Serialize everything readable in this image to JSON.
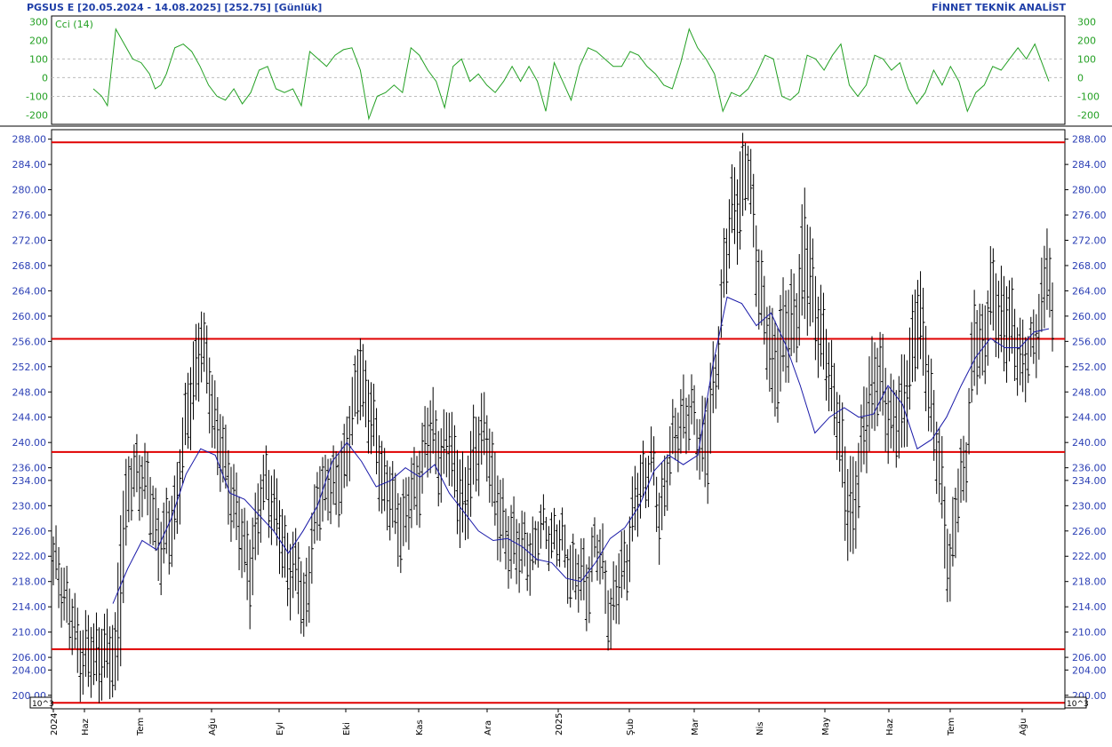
{
  "header": {
    "left": "PGSUS E  [20.05.2024 - 14.08.2025]  [252.75]  [Günlük]",
    "right": "FİNNET TEKNİK ANALİST"
  },
  "indicator": {
    "label": "Cci (14)",
    "color": "#23a023",
    "ticks": [
      "300",
      "200",
      "100",
      "0",
      "-100",
      "-200"
    ],
    "tick_values": [
      300,
      200,
      100,
      0,
      -100,
      -200
    ],
    "ylim": [
      -250,
      330
    ]
  },
  "scale_label": "10^3",
  "colors": {
    "price_bar": "#000000",
    "moving_average": "#1a1aa8",
    "levels": "#e00000",
    "cci": "#23a023",
    "axis_text": "#2b3fb5"
  },
  "chart_data": {
    "type": "bar",
    "title": "PGSUS E",
    "date_range": "20.05.2024 - 14.08.2025",
    "last_price": 252.75,
    "period": "Günlük",
    "ylim": [
      198,
      289.5
    ],
    "y_ticks": [
      288,
      284,
      280,
      276,
      272,
      268,
      264,
      260,
      256,
      252,
      248,
      244,
      240,
      236,
      234,
      230,
      226,
      222,
      218,
      214,
      210,
      206,
      204,
      200
    ],
    "x_labels": [
      "2024",
      "Haz",
      "Tem",
      "Ağu",
      "Eyl",
      "Eki",
      "Kas",
      "Ara",
      "2025",
      "Şub",
      "Mar",
      "Nis",
      "May",
      "Haz",
      "Tem",
      "Ağu"
    ],
    "horizontal_levels": [
      287.5,
      256.4,
      238.5,
      207.3,
      198.8
    ],
    "ohlc_keypoints": [
      [
        0,
        216,
        224
      ],
      [
        3,
        214,
        222
      ],
      [
        6,
        208,
        216
      ],
      [
        9,
        203,
        212
      ],
      [
        12,
        201,
        211
      ],
      [
        15,
        200,
        210
      ],
      [
        18,
        202,
        212
      ],
      [
        21,
        200,
        210
      ],
      [
        23,
        199,
        211
      ],
      [
        25,
        208,
        230
      ],
      [
        28,
        227,
        236
      ],
      [
        31,
        232,
        240
      ],
      [
        34,
        228,
        237
      ],
      [
        37,
        224,
        233
      ],
      [
        40,
        218,
        228
      ],
      [
        43,
        220,
        230
      ],
      [
        46,
        226,
        236
      ],
      [
        49,
        236,
        246
      ],
      [
        52,
        244,
        256
      ],
      [
        55,
        250,
        260
      ],
      [
        58,
        244,
        254
      ],
      [
        61,
        235,
        246
      ],
      [
        64,
        230,
        240
      ],
      [
        67,
        226,
        236
      ],
      [
        70,
        218,
        228
      ],
      [
        73,
        214,
        226
      ],
      [
        76,
        222,
        232
      ],
      [
        79,
        230,
        238
      ],
      [
        82,
        224,
        234
      ],
      [
        85,
        218,
        228
      ],
      [
        88,
        215,
        225
      ],
      [
        91,
        213,
        223
      ],
      [
        93,
        208,
        218
      ],
      [
        96,
        218,
        228
      ],
      [
        99,
        226,
        236
      ],
      [
        102,
        230,
        238
      ],
      [
        105,
        226,
        236
      ],
      [
        108,
        232,
        242
      ],
      [
        111,
        238,
        248
      ],
      [
        114,
        246,
        257
      ],
      [
        117,
        240,
        250
      ],
      [
        120,
        234,
        244
      ],
      [
        123,
        228,
        238
      ],
      [
        126,
        224,
        234
      ],
      [
        129,
        222,
        232
      ],
      [
        132,
        224,
        234
      ],
      [
        135,
        228,
        238
      ],
      [
        138,
        234,
        244
      ],
      [
        141,
        236,
        246
      ],
      [
        144,
        232,
        242
      ],
      [
        147,
        234,
        244
      ],
      [
        150,
        228,
        240
      ],
      [
        153,
        222,
        234
      ],
      [
        156,
        232,
        244
      ],
      [
        159,
        236,
        246
      ],
      [
        162,
        232,
        242
      ],
      [
        165,
        224,
        236
      ],
      [
        168,
        218,
        228
      ],
      [
        171,
        220,
        230
      ],
      [
        174,
        217,
        226
      ],
      [
        177,
        218,
        226
      ],
      [
        180,
        222,
        228
      ],
      [
        183,
        223,
        228
      ],
      [
        186,
        222,
        228
      ],
      [
        189,
        220,
        226
      ],
      [
        192,
        216,
        224
      ],
      [
        195,
        214,
        222
      ],
      [
        198,
        212,
        222
      ],
      [
        201,
        220,
        226
      ],
      [
        204,
        216,
        224
      ],
      [
        207,
        208,
        216
      ],
      [
        210,
        212,
        222
      ],
      [
        213,
        218,
        226
      ],
      [
        216,
        224,
        234
      ],
      [
        219,
        230,
        238
      ],
      [
        222,
        234,
        240
      ],
      [
        225,
        222,
        232
      ],
      [
        228,
        232,
        240
      ],
      [
        231,
        236,
        244
      ],
      [
        234,
        240,
        249
      ],
      [
        237,
        240,
        247
      ],
      [
        240,
        236,
        244
      ],
      [
        243,
        232,
        248
      ],
      [
        246,
        246,
        254
      ],
      [
        249,
        262,
        272
      ],
      [
        252,
        270,
        280
      ],
      [
        255,
        272,
        286
      ],
      [
        258,
        279,
        287
      ],
      [
        261,
        264,
        276
      ],
      [
        264,
        254,
        264
      ],
      [
        267,
        244,
        258
      ],
      [
        270,
        248,
        262
      ],
      [
        273,
        250,
        264
      ],
      [
        276,
        256,
        266
      ],
      [
        279,
        258,
        278
      ],
      [
        282,
        258,
        270
      ],
      [
        285,
        250,
        262
      ],
      [
        288,
        246,
        256
      ],
      [
        291,
        240,
        250
      ],
      [
        294,
        224,
        238
      ],
      [
        297,
        222,
        236
      ],
      [
        300,
        232,
        242
      ],
      [
        303,
        240,
        254
      ],
      [
        306,
        244,
        256
      ],
      [
        309,
        240,
        252
      ],
      [
        312,
        238,
        248
      ],
      [
        315,
        236,
        250
      ],
      [
        318,
        246,
        258
      ],
      [
        321,
        252,
        266
      ],
      [
        324,
        248,
        260
      ],
      [
        327,
        236,
        246
      ],
      [
        330,
        226,
        238
      ],
      [
        333,
        214,
        224
      ],
      [
        336,
        226,
        236
      ],
      [
        339,
        234,
        242
      ],
      [
        342,
        248,
        262
      ],
      [
        345,
        250,
        260
      ],
      [
        348,
        256,
        268
      ],
      [
        351,
        254,
        266
      ],
      [
        354,
        252,
        266
      ],
      [
        357,
        250,
        260
      ],
      [
        360,
        248,
        258
      ],
      [
        363,
        250,
        256
      ],
      [
        366,
        254,
        264
      ],
      [
        369,
        262,
        274
      ],
      [
        371,
        252,
        262
      ]
    ],
    "moving_average": [
      [
        23,
        214.5
      ],
      [
        28,
        220
      ],
      [
        33,
        224.5
      ],
      [
        38,
        223
      ],
      [
        43,
        228
      ],
      [
        48,
        235
      ],
      [
        53,
        239
      ],
      [
        58,
        238
      ],
      [
        63,
        232
      ],
      [
        68,
        231
      ],
      [
        73,
        228.5
      ],
      [
        78,
        226
      ],
      [
        83,
        222.5
      ],
      [
        88,
        226
      ],
      [
        93,
        230
      ],
      [
        98,
        237
      ],
      [
        103,
        240
      ],
      [
        108,
        237
      ],
      [
        113,
        233
      ],
      [
        118,
        234
      ],
      [
        123,
        236
      ],
      [
        128,
        234.5
      ],
      [
        133,
        236.5
      ],
      [
        138,
        232
      ],
      [
        143,
        229
      ],
      [
        148,
        226
      ],
      [
        153,
        224.5
      ],
      [
        158,
        224.8
      ],
      [
        163,
        223.5
      ],
      [
        168,
        221.5
      ],
      [
        173,
        221
      ],
      [
        178,
        218.5
      ],
      [
        183,
        218
      ],
      [
        188,
        221
      ],
      [
        193,
        224.8
      ],
      [
        198,
        226.5
      ],
      [
        203,
        230
      ],
      [
        208,
        235.5
      ],
      [
        213,
        238
      ],
      [
        218,
        236.5
      ],
      [
        223,
        238
      ],
      [
        228,
        252
      ],
      [
        233,
        263
      ],
      [
        238,
        262
      ],
      [
        243,
        258.5
      ],
      [
        248,
        260.5
      ],
      [
        253,
        255.5
      ],
      [
        258,
        249
      ],
      [
        263,
        241.5
      ],
      [
        268,
        244
      ],
      [
        273,
        245.5
      ],
      [
        278,
        244
      ],
      [
        283,
        244.5
      ],
      [
        288,
        249
      ],
      [
        293,
        246
      ],
      [
        298,
        239
      ],
      [
        303,
        240.5
      ],
      [
        308,
        244
      ],
      [
        313,
        249
      ],
      [
        318,
        253.5
      ],
      [
        323,
        256.5
      ],
      [
        328,
        255
      ],
      [
        333,
        255
      ],
      [
        338,
        257.5
      ],
      [
        343,
        258
      ]
    ],
    "indicator_series": {
      "name": "Cci (14)",
      "values": [
        [
          0,
          -60
        ],
        [
          3,
          -100
        ],
        [
          5,
          -150
        ],
        [
          8,
          260
        ],
        [
          11,
          180
        ],
        [
          14,
          100
        ],
        [
          17,
          80
        ],
        [
          20,
          20
        ],
        [
          22,
          -60
        ],
        [
          24,
          -40
        ],
        [
          26,
          20
        ],
        [
          29,
          160
        ],
        [
          32,
          180
        ],
        [
          35,
          140
        ],
        [
          38,
          60
        ],
        [
          41,
          -40
        ],
        [
          44,
          -100
        ],
        [
          47,
          -120
        ],
        [
          50,
          -60
        ],
        [
          53,
          -140
        ],
        [
          56,
          -80
        ],
        [
          59,
          40
        ],
        [
          62,
          60
        ],
        [
          65,
          -60
        ],
        [
          68,
          -80
        ],
        [
          71,
          -60
        ],
        [
          74,
          -150
        ],
        [
          77,
          140
        ],
        [
          80,
          100
        ],
        [
          83,
          60
        ],
        [
          86,
          120
        ],
        [
          89,
          150
        ],
        [
          92,
          160
        ],
        [
          95,
          40
        ],
        [
          98,
          -220
        ],
        [
          101,
          -100
        ],
        [
          104,
          -80
        ],
        [
          107,
          -40
        ],
        [
          110,
          -80
        ],
        [
          113,
          160
        ],
        [
          116,
          120
        ],
        [
          119,
          40
        ],
        [
          122,
          -20
        ],
        [
          125,
          -160
        ],
        [
          128,
          60
        ],
        [
          131,
          100
        ],
        [
          134,
          -20
        ],
        [
          137,
          20
        ],
        [
          140,
          -40
        ],
        [
          143,
          -80
        ],
        [
          146,
          -20
        ],
        [
          149,
          60
        ],
        [
          152,
          -20
        ],
        [
          155,
          60
        ],
        [
          158,
          -20
        ],
        [
          161,
          -180
        ],
        [
          164,
          80
        ],
        [
          167,
          -20
        ],
        [
          170,
          -120
        ],
        [
          173,
          60
        ],
        [
          176,
          160
        ],
        [
          179,
          140
        ],
        [
          182,
          100
        ],
        [
          185,
          60
        ],
        [
          188,
          60
        ],
        [
          191,
          140
        ],
        [
          194,
          120
        ],
        [
          197,
          60
        ],
        [
          200,
          20
        ],
        [
          203,
          -40
        ],
        [
          206,
          -60
        ],
        [
          209,
          80
        ],
        [
          212,
          260
        ],
        [
          215,
          160
        ],
        [
          218,
          100
        ],
        [
          221,
          20
        ],
        [
          224,
          -180
        ],
        [
          227,
          -80
        ],
        [
          230,
          -100
        ],
        [
          233,
          -60
        ],
        [
          236,
          20
        ],
        [
          239,
          120
        ],
        [
          242,
          100
        ],
        [
          245,
          -100
        ],
        [
          248,
          -120
        ],
        [
          251,
          -80
        ],
        [
          254,
          120
        ],
        [
          257,
          100
        ],
        [
          260,
          40
        ],
        [
          263,
          120
        ],
        [
          266,
          180
        ],
        [
          269,
          -40
        ],
        [
          272,
          -100
        ],
        [
          275,
          -40
        ],
        [
          278,
          120
        ],
        [
          281,
          100
        ],
        [
          284,
          40
        ],
        [
          287,
          80
        ],
        [
          290,
          -60
        ],
        [
          293,
          -140
        ],
        [
          296,
          -80
        ],
        [
          299,
          40
        ],
        [
          302,
          -40
        ],
        [
          305,
          60
        ],
        [
          308,
          -20
        ],
        [
          311,
          -180
        ],
        [
          314,
          -80
        ],
        [
          317,
          -40
        ],
        [
          320,
          60
        ],
        [
          323,
          40
        ],
        [
          326,
          100
        ],
        [
          329,
          160
        ],
        [
          332,
          100
        ],
        [
          335,
          180
        ],
        [
          338,
          60
        ],
        [
          340,
          -20
        ]
      ]
    }
  }
}
